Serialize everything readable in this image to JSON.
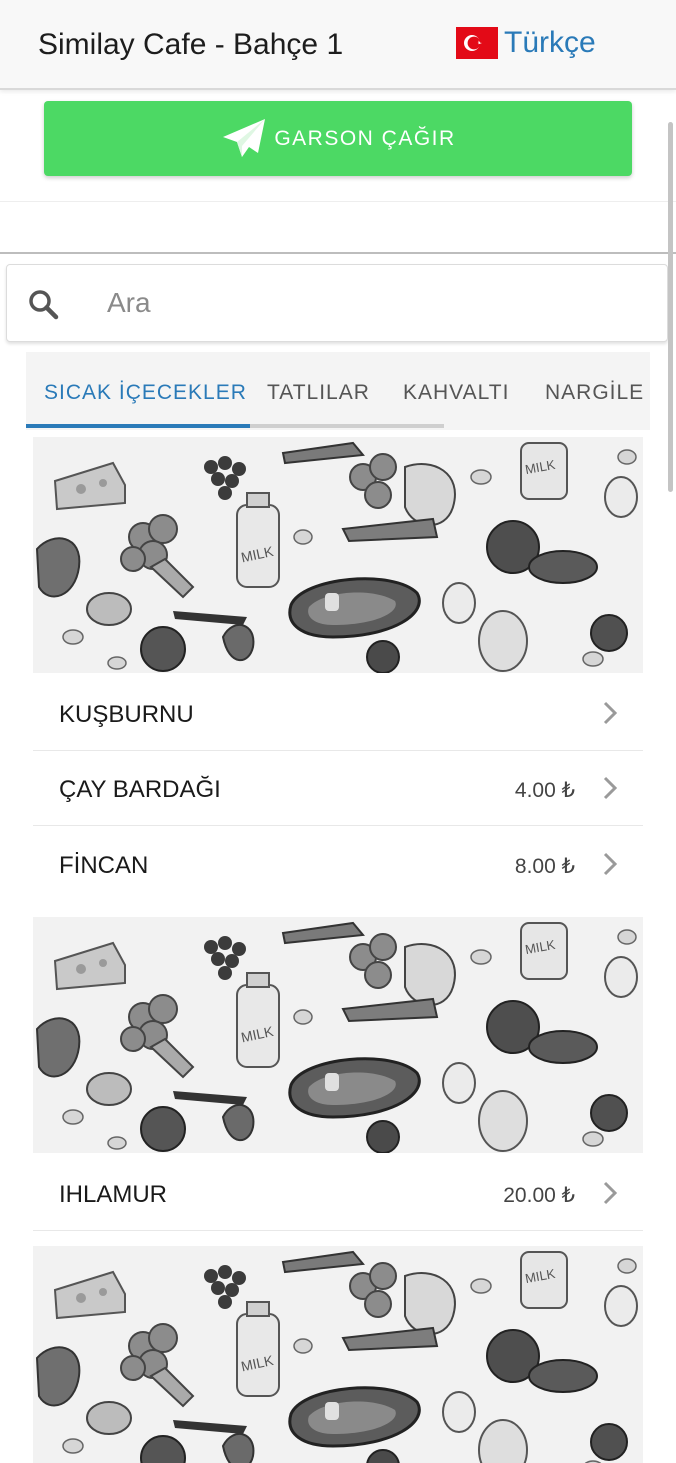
{
  "header": {
    "title": "Similay Cafe - Bahçe 1",
    "language": {
      "label": "Türkçe",
      "flag_icon": "turkey-flag-icon"
    }
  },
  "call_button": {
    "label": "GARSON ÇAĞIR",
    "icon": "paper-plane-icon",
    "color": "#4cd964"
  },
  "search": {
    "placeholder": "Ara",
    "value": "",
    "icon": "search-icon"
  },
  "tabs": {
    "items": [
      {
        "label": "SICAK İÇECEKLER",
        "active": true
      },
      {
        "label": "TATLILAR",
        "active": false
      },
      {
        "label": "KAHVALTI",
        "active": false
      },
      {
        "label": "NARGİLE",
        "active": false
      }
    ],
    "accent_color": "#2a7ab8"
  },
  "menu": {
    "items": [
      {
        "name": "KUŞBURNU",
        "price": ""
      },
      {
        "name": "ÇAY BARDAĞI",
        "price": "4.00 ₺"
      },
      {
        "name": "FİNCAN",
        "price": "8.00 ₺"
      },
      {
        "name": "IHLAMUR",
        "price": "20.00 ₺"
      }
    ],
    "banner_image": "food-pattern-image"
  }
}
